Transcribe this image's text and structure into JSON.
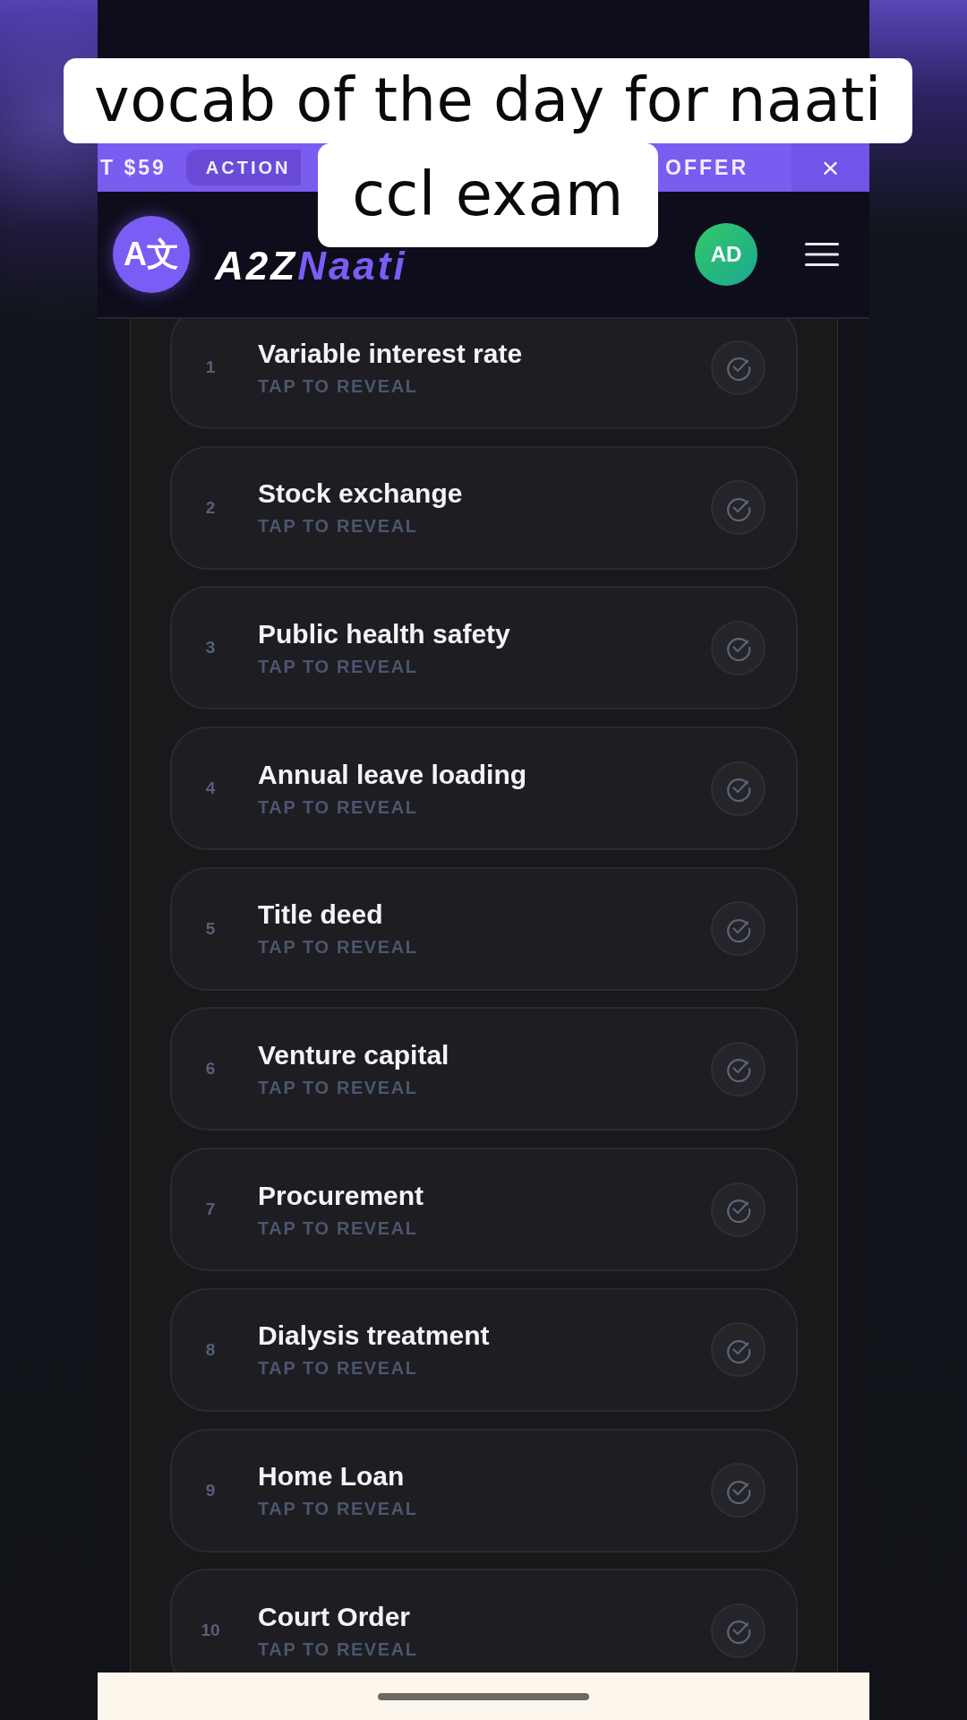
{
  "caption": {
    "lines": [
      "vocab of the day for naati",
      "ccl exam"
    ]
  },
  "promo_banner": {
    "price": "T $59",
    "action": "ACTION",
    "offer": "OFFER",
    "close": "×"
  },
  "header": {
    "logo_badge": "A文",
    "brand": {
      "text": "A2Z",
      "accent": "Naati"
    },
    "avatar": "AD"
  },
  "vocab_list": [
    {
      "number": "1",
      "term": "Variable interest rate",
      "hint": "TAP TO REVEAL"
    },
    {
      "number": "2",
      "term": "Stock exchange",
      "hint": "TAP TO REVEAL"
    },
    {
      "number": "3",
      "term": "Public health safety",
      "hint": "TAP TO REVEAL"
    },
    {
      "number": "4",
      "term": "Annual leave loading",
      "hint": "TAP TO REVEAL"
    },
    {
      "number": "5",
      "term": "Title deed",
      "hint": "TAP TO REVEAL"
    },
    {
      "number": "6",
      "term": "Venture capital",
      "hint": "TAP TO REVEAL"
    },
    {
      "number": "7",
      "term": "Procurement",
      "hint": "TAP TO REVEAL"
    },
    {
      "number": "8",
      "term": "Dialysis treatment",
      "hint": "TAP TO REVEAL"
    },
    {
      "number": "9",
      "term": "Home Loan",
      "hint": "TAP TO REVEAL"
    },
    {
      "number": "10",
      "term": "Court Order",
      "hint": "TAP TO REVEAL"
    }
  ]
}
